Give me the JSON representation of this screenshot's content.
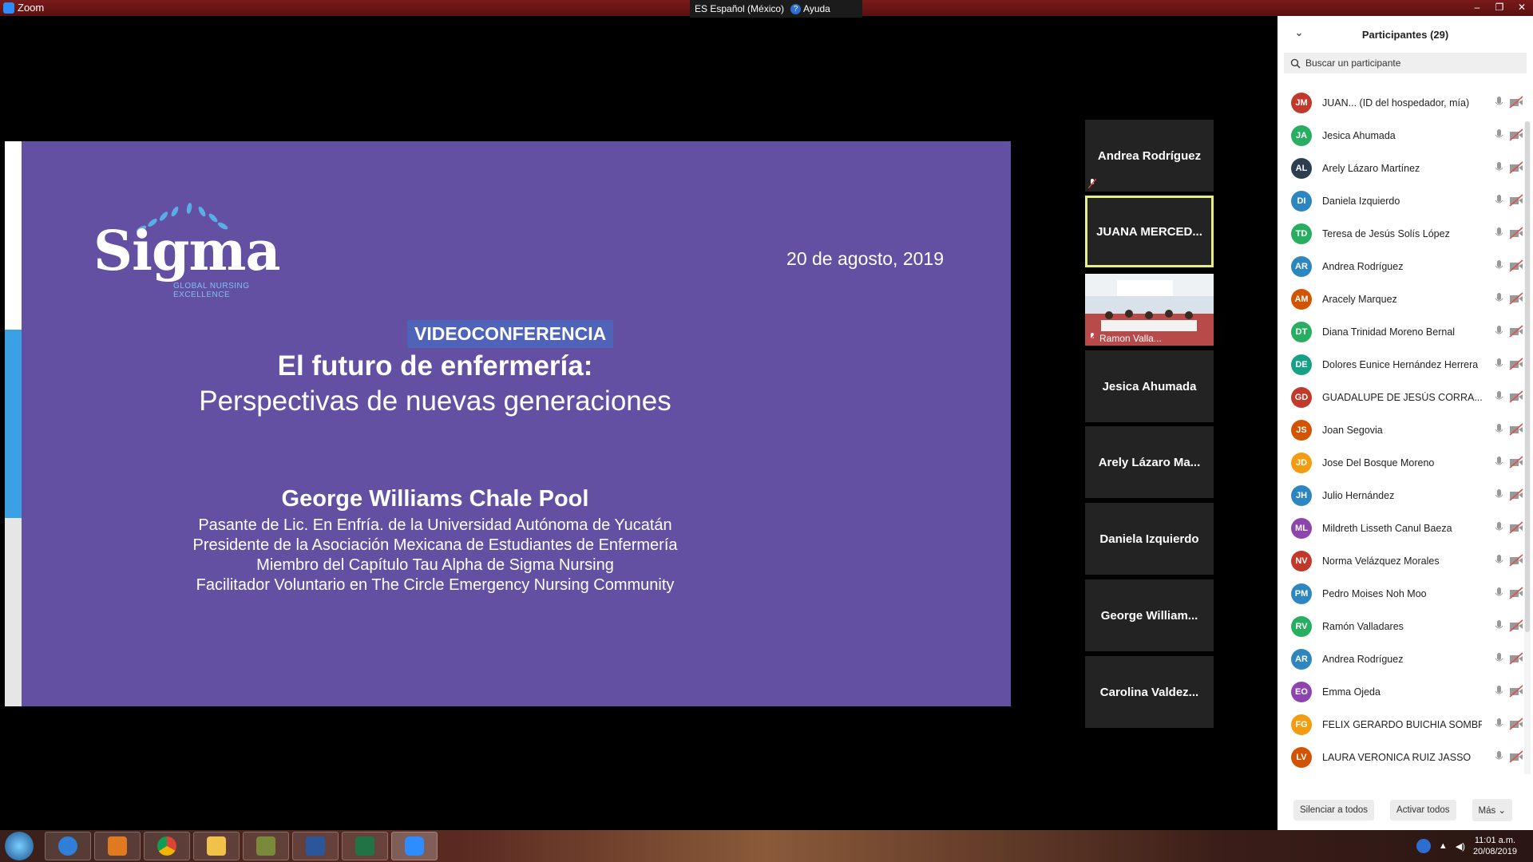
{
  "window": {
    "title": "Zoom",
    "controls": [
      "–",
      "❐",
      "✕"
    ]
  },
  "langbar": {
    "language": "ES Español (México)",
    "help": "Ayuda"
  },
  "slide": {
    "logo_word": "Sigma",
    "logo_tag_line1": "GLOBAL NURSING",
    "logo_tag_line2": "EXCELLENCE",
    "date": "20 de agosto, 2019",
    "badge": "VIDEOCONFERENCIA",
    "title_line1": "El futuro de enfermería:",
    "title_line2": "Perspectivas de nuevas generaciones",
    "speaker": "George Williams Chale Pool",
    "credentials": [
      "Pasante de Lic. En Enfría. de la Universidad Autónoma de Yucatán",
      "Presidente de la Asociación Mexicana de Estudiantes de Enfermería",
      "Miembro del Capítulo Tau Alpha de Sigma Nursing",
      "Facilitador Voluntario en The Circle Emergency Nursing Community"
    ]
  },
  "gallery": {
    "tiles": [
      {
        "name": "Andrea Rodríguez"
      },
      {
        "name": "JUANA MERCED..."
      },
      {
        "name": "Ramon Valla..."
      },
      {
        "name": "Jesica Ahumada"
      },
      {
        "name": "Arely Lázaro Ma..."
      },
      {
        "name": "Daniela Izquierdo"
      },
      {
        "name": "George William..."
      },
      {
        "name": "Carolina Valdez..."
      }
    ]
  },
  "participants": {
    "header": "Participantes (29)",
    "search_placeholder": "Buscar un participante",
    "list": [
      {
        "initials": "JM",
        "name": "JUAN... (ID del hospedador, mía)",
        "color": "#c0392b"
      },
      {
        "initials": "JA",
        "name": "Jesica Ahumada",
        "color": "#27ae60"
      },
      {
        "initials": "AL",
        "name": "Arely Lázaro Martínez",
        "color": "#2c3e50"
      },
      {
        "initials": "DI",
        "name": "Daniela Izquierdo",
        "color": "#2e86c1"
      },
      {
        "initials": "TD",
        "name": "Teresa de Jesús Solís López",
        "color": "#27ae60"
      },
      {
        "initials": "AR",
        "name": "Andrea Rodríguez",
        "color": "#2e86c1"
      },
      {
        "initials": "AM",
        "name": "Aracely Marquez",
        "color": "#d35400"
      },
      {
        "initials": "DT",
        "name": "Diana Trinidad Moreno Bernal",
        "color": "#27ae60"
      },
      {
        "initials": "DE",
        "name": "Dolores Eunice Hernández Herrera",
        "color": "#16a085"
      },
      {
        "initials": "GD",
        "name": "GUADALUPE DE JESÚS CORRA...",
        "color": "#c0392b"
      },
      {
        "initials": "JS",
        "name": "Joan Segovia",
        "color": "#d35400"
      },
      {
        "initials": "JD",
        "name": "Jose Del Bosque Moreno",
        "color": "#f39c12"
      },
      {
        "initials": "JH",
        "name": "Julio Hernández",
        "color": "#2e86c1"
      },
      {
        "initials": "ML",
        "name": "Mildreth Lisseth Canul Baeza",
        "color": "#8e44ad"
      },
      {
        "initials": "NV",
        "name": "Norma Velázquez Morales",
        "color": "#c0392b"
      },
      {
        "initials": "PM",
        "name": "Pedro Moises Noh Moo",
        "color": "#2e86c1"
      },
      {
        "initials": "RV",
        "name": "Ramón Valladares",
        "color": "#27ae60"
      },
      {
        "initials": "AR",
        "name": "Andrea Rodríguez",
        "color": "#2e86c1"
      },
      {
        "initials": "EO",
        "name": "Emma Ojeda",
        "color": "#8e44ad"
      },
      {
        "initials": "FG",
        "name": "FELIX GERARDO BUICHIA SOMBRA",
        "color": "#f39c12"
      },
      {
        "initials": "LV",
        "name": "LAURA VERONICA RUIZ JASSO",
        "color": "#d35400"
      }
    ],
    "footer": {
      "mute_all": "Silenciar a todos",
      "unmute_all": "Activar todos",
      "more": "Más ⌄"
    }
  },
  "taskbar": {
    "time": "11:01 a.m.",
    "date": "20/08/2019"
  },
  "colors": {
    "slide_bg": "#6350a2",
    "badge_bg": "#4f63b8",
    "active_border": "#e6f082",
    "muted_red": "#d9534f"
  }
}
